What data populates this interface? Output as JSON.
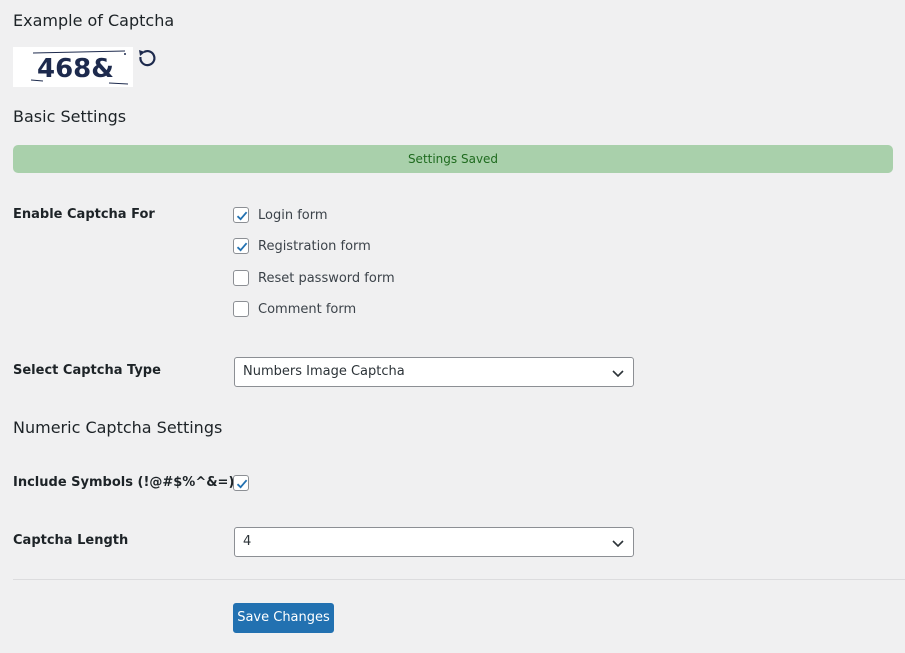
{
  "example_section": {
    "title": "Example of Captcha",
    "captcha_text": "468&"
  },
  "basic_settings": {
    "title": "Basic Settings",
    "notice": "Settings Saved"
  },
  "enable_captcha": {
    "label": "Enable Captcha For",
    "options": [
      {
        "label": "Login form",
        "checked": true
      },
      {
        "label": "Registration form",
        "checked": true
      },
      {
        "label": "Reset password form",
        "checked": false
      },
      {
        "label": "Comment form",
        "checked": false
      }
    ]
  },
  "captcha_type": {
    "label": "Select Captcha Type",
    "selected": "Numbers Image Captcha"
  },
  "numeric_settings": {
    "title": "Numeric Captcha Settings",
    "include_symbols_label": "Include Symbols (!@#$%^&=)",
    "include_symbols_checked": true,
    "length_label": "Captcha Length",
    "length_selected": "4"
  },
  "actions": {
    "save_label": "Save Changes"
  },
  "colors": {
    "notice_bg": "#a9d0ab",
    "primary_button": "#2271b1",
    "checkmark": "#2271b1"
  }
}
